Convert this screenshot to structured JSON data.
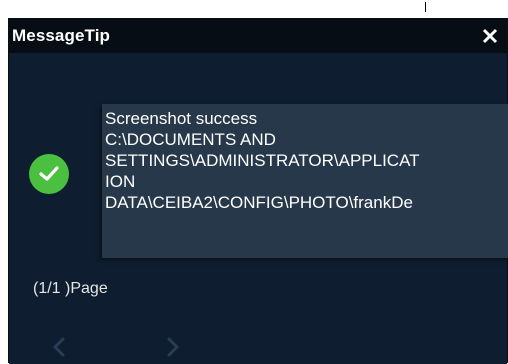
{
  "dialog": {
    "title": "MessageTip",
    "close_icon": "close-icon",
    "status_icon": "checkmark-icon",
    "message_lines": [
      "Screenshot success",
      "C:\\DOCUMENTS AND",
      "SETTINGS\\ADMINISTRATOR\\APPLICAT",
      "ION",
      "DATA\\CEIBA2\\CONFIG\\PHOTO\\frankDe"
    ],
    "page_info": "(1/1 )Page",
    "prev_icon": "chevron-left-icon",
    "next_icon": "chevron-right-icon"
  },
  "colors": {
    "background": "#0e1e30",
    "titlebar": "#070d14",
    "message_box": "#26384a",
    "success": "#4bbf3f",
    "nav_disabled": "#2b3d55"
  }
}
